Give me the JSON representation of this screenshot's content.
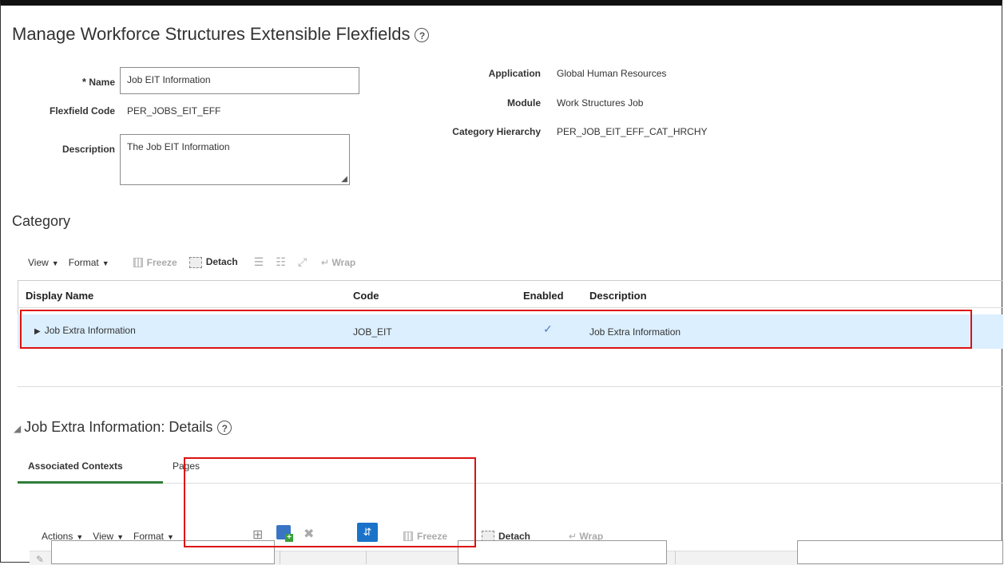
{
  "page": {
    "title": "Manage Workforce Structures Extensible Flexfields",
    "help": "?"
  },
  "form": {
    "name_label": "Name",
    "required_mark": "*",
    "name_value": "Job EIT Information",
    "flexfield_code_label": "Flexfield Code",
    "flexfield_code_value": "PER_JOBS_EIT_EFF",
    "description_label": "Description",
    "description_value": "The Job EIT Information",
    "application_label": "Application",
    "application_value": "Global Human Resources",
    "module_label": "Module",
    "module_value": "Work Structures Job",
    "category_hierarchy_label": "Category Hierarchy",
    "category_hierarchy_value": "PER_JOB_EIT_EFF_CAT_HRCHY"
  },
  "category": {
    "title": "Category",
    "toolbar": {
      "view": "View",
      "format": "Format",
      "freeze": "Freeze",
      "detach": "Detach",
      "wrap": "Wrap"
    },
    "columns": [
      "Display Name",
      "Code",
      "Enabled",
      "Description"
    ],
    "rows": [
      {
        "display_name": "Job Extra Information",
        "code": "JOB_EIT",
        "enabled": "✓",
        "description": "Job Extra Information"
      }
    ]
  },
  "details": {
    "title": "Job Extra Information: Details",
    "help": "?",
    "tabs": [
      "Associated Contexts",
      "Pages"
    ],
    "toolbar": {
      "actions": "Actions",
      "view": "View",
      "format": "Format",
      "freeze": "Freeze",
      "detach": "Detach",
      "wrap": "Wrap"
    }
  },
  "colors": {
    "selected_row": "#dcefff",
    "highlight": "#dd1111",
    "accent": "#0572ce"
  }
}
